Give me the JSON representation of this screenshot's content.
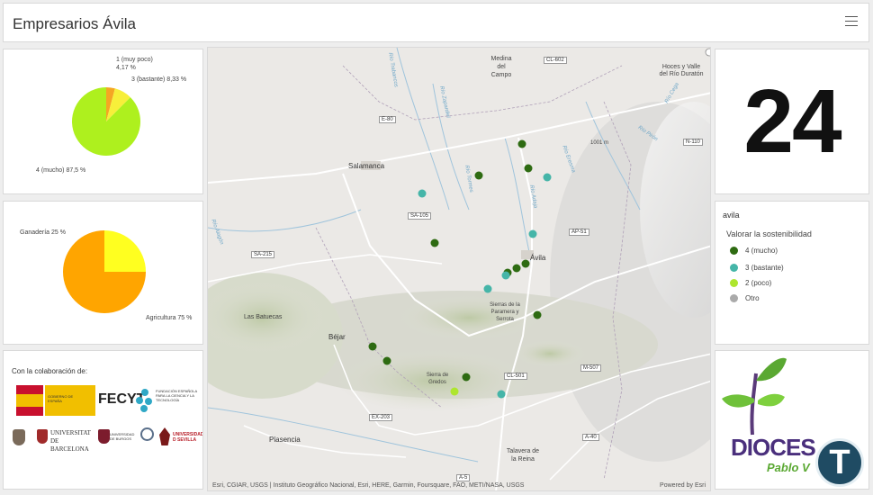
{
  "header": {
    "title": "Empresarios Ávila"
  },
  "pie_sustainability": {
    "slices": [
      {
        "label": "1 (muy poco)",
        "value": "4,17 %",
        "pct": 4.17,
        "color": "#f5a623"
      },
      {
        "label": "3 (bastante)",
        "value": "8,33 %",
        "pct": 8.33,
        "color": "#f7ef3a"
      },
      {
        "label": "4 (mucho)",
        "value": "87,5 %",
        "pct": 87.5,
        "color": "#aef01e"
      }
    ],
    "label_1": "1 (muy poco)",
    "label_1_value": "4,17 %",
    "label_3": "3 (bastante) 8,33 %",
    "label_4": "4 (mucho) 87,5 %"
  },
  "pie_sector": {
    "slices": [
      {
        "label": "Ganadería",
        "value": "25 %",
        "pct": 25,
        "color": "#ffff20"
      },
      {
        "label": "Agricultura",
        "value": "75 %",
        "pct": 75,
        "color": "#ffa500"
      }
    ],
    "label_ganaderia": "Ganadería 25 %",
    "label_agricultura": "Agricultura 75 %"
  },
  "collab": {
    "title": "Con la colaboración de:",
    "fecyt": "FECYT",
    "fecyt_sub": "FUNDACIÓN ESPAÑOLA PARA LA CIENCIA Y LA TECNOLOGÍA",
    "ministerio": "GOBIERNO DE ESPAÑA",
    "barcelona": "UNIVERSITAT DE BARCELONA",
    "burgos": "UNIVERSIDAD DE BURGOS",
    "sevilla": "UNIVERSIDAD D SEVILLA"
  },
  "map": {
    "labels": {
      "salamanca": "Salamanca",
      "avila": "Ávila",
      "medina": "Medina del Campo",
      "hoces": "Hoces y Valle del Río Duratón",
      "las_batuecas": "Las Batuecas",
      "bejar": "Béjar",
      "plasencia": "Plasencia",
      "talavera": "Talavera de la Reina",
      "sierra_paramera": "Sierras de la Paramera y Serrota",
      "sierra_gredos": "Sierra de Gredos",
      "distance": "1001 m",
      "rio_trabancos": "Río Trabancos",
      "rio_zapardiel": "Río Zapardiel",
      "rio_adaja": "Río Adaja",
      "rio_eresma": "Río Eresma",
      "rio_cega": "Río Cega",
      "rio_pirón": "Río Pirón",
      "rio_alagon": "Río Alagón",
      "rio_tormes": "Río Tormes"
    },
    "roads": {
      "e80": "E-80",
      "cl602": "CL-602",
      "n110": "N-110",
      "sa105": "SA-105",
      "ap51": "AP-51",
      "sa215": "SA-215",
      "cl501": "CL-501",
      "m507": "M-507",
      "ex203": "EX-203",
      "a40": "A-40",
      "a5": "A-5"
    },
    "attribution": "Esri, CGIAR, USGS | Instituto Geográfico Nacional, Esri, HERE, Garmin, Foursquare, FAO, METI/NASA, USGS",
    "powered": "Powered by Esri",
    "points": [
      {
        "cat": "4 (mucho)"
      },
      {
        "cat": "4 (mucho)"
      },
      {
        "cat": "4 (mucho)"
      },
      {
        "cat": "4 (mucho)"
      },
      {
        "cat": "4 (mucho)"
      },
      {
        "cat": "4 (mucho)"
      },
      {
        "cat": "4 (mucho)"
      },
      {
        "cat": "4 (mucho)"
      },
      {
        "cat": "4 (mucho)"
      },
      {
        "cat": "4 (mucho)"
      },
      {
        "cat": "4 (mucho)"
      },
      {
        "cat": "3 (bastante)"
      },
      {
        "cat": "3 (bastante)"
      },
      {
        "cat": "3 (bastante)"
      },
      {
        "cat": "3 (bastante)"
      },
      {
        "cat": "3 (bastante)"
      },
      {
        "cat": "3 (bastante)"
      },
      {
        "cat": "2 (poco)"
      }
    ]
  },
  "counter": {
    "value": "24"
  },
  "legend": {
    "title": "avila",
    "subtitle": "Valorar la sostenibilidad",
    "items": [
      {
        "label": "4 (mucho)",
        "color": "#2e6b12"
      },
      {
        "label": "3 (bastante)",
        "color": "#45b5a8"
      },
      {
        "label": "2 (poco)",
        "color": "#aee62e"
      },
      {
        "label": "Otro",
        "color": "#aaaaaa"
      }
    ]
  },
  "dioces": {
    "name": "DIOCES",
    "sub": "Pablo V"
  },
  "badge": {
    "letter": "T"
  }
}
